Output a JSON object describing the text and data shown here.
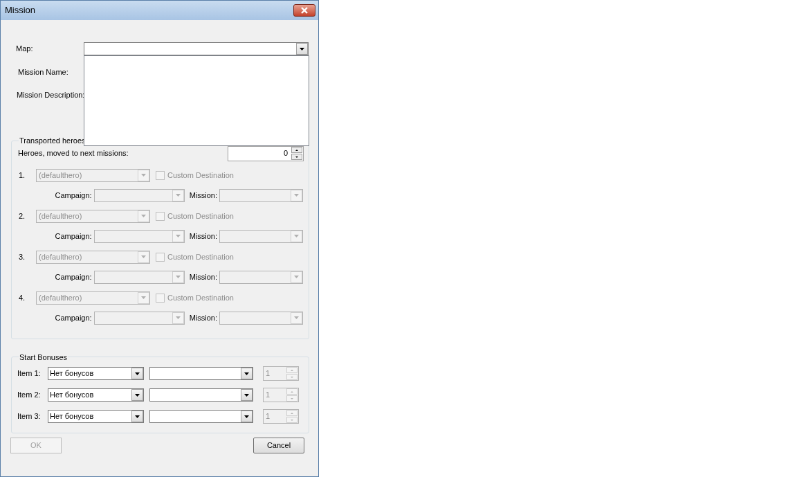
{
  "window": {
    "title": "Mission"
  },
  "map": {
    "label": "Map:"
  },
  "mission_name": {
    "label": "Mission Name:"
  },
  "mission_description": {
    "label": "Mission Description:"
  },
  "transported_heroes": {
    "title": "Transported heroes",
    "count_label": "Heroes, moved to next missions:",
    "count_value": "0",
    "heroes": [
      {
        "number": "1.",
        "hero": "(defaulthero)",
        "disabled": true,
        "custom_destination": {
          "label": "Custom Destination",
          "checked": false,
          "disabled": true
        },
        "campaign_label": "Campaign:",
        "mission_label": "Mission:"
      },
      {
        "number": "2.",
        "hero": "(defaulthero)",
        "disabled": true,
        "custom_destination": {
          "label": "Custom Destination",
          "checked": false,
          "disabled": true
        },
        "campaign_label": "Campaign:",
        "mission_label": "Mission:"
      },
      {
        "number": "3.",
        "hero": "(defaulthero)",
        "disabled": true,
        "custom_destination": {
          "label": "Custom Destination",
          "checked": false,
          "disabled": true
        },
        "campaign_label": "Campaign:",
        "mission_label": "Mission:"
      },
      {
        "number": "4.",
        "hero": "(defaulthero)",
        "disabled": true,
        "custom_destination": {
          "label": "Custom Destination",
          "checked": false,
          "disabled": true
        },
        "campaign_label": "Campaign:",
        "mission_label": "Mission:"
      }
    ]
  },
  "start_bonuses": {
    "title": "Start Bonuses",
    "items": [
      {
        "label": "Item 1:",
        "bonus": "Нет бонусов",
        "quantity": "1",
        "quantity_disabled": true
      },
      {
        "label": "Item 2:",
        "bonus": "Нет бонусов",
        "quantity": "1",
        "quantity_disabled": true
      },
      {
        "label": "Item 3:",
        "bonus": "Нет бонусов",
        "quantity": "1",
        "quantity_disabled": true
      }
    ]
  },
  "buttons": [
    {
      "label": "OK",
      "disabled": true
    },
    {
      "label": "Cancel",
      "disabled": false
    }
  ]
}
